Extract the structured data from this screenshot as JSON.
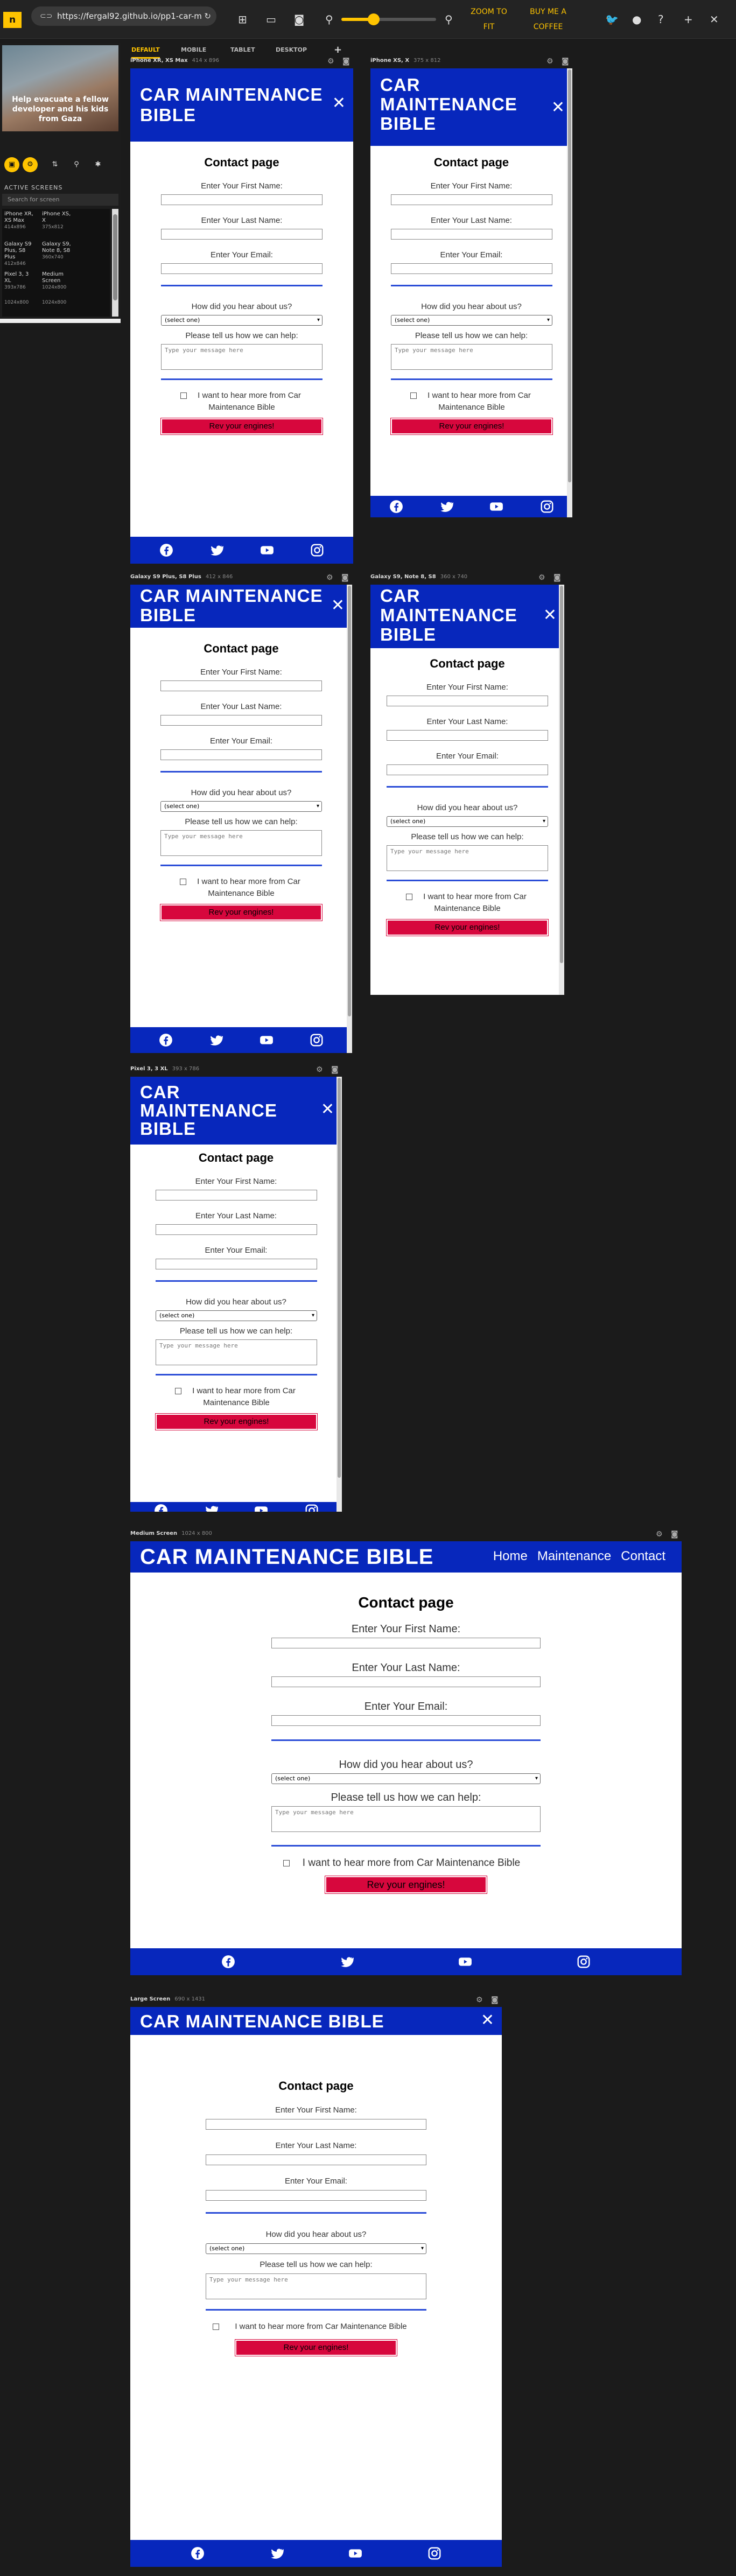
{
  "toolbar": {
    "logo": "n",
    "url": "https://fergal92.github.io/pp1-car-m",
    "zoom_level": 0.34,
    "zoom_to_fit": "ZOOM TO FIT",
    "buy_coffee": "BUY ME A COFFEE"
  },
  "tabs": [
    "DEFAULT",
    "MOBILE",
    "TABLET",
    "DESKTOP"
  ],
  "sidebar": {
    "ad_text": "Help evacuate a fellow developer and his kids from Gaza",
    "active_screens": "ACTIVE SCREENS",
    "search_placeholder": "Search for screen",
    "devices": [
      {
        "name": "iPhone XR, XS Max",
        "size": "414x896"
      },
      {
        "name": "iPhone XS, X",
        "size": "375x812"
      },
      {
        "name": "Galaxy S9 Plus, S8 Plus",
        "size": "412x846"
      },
      {
        "name": "Galaxy S9, Note 8, S8",
        "size": "360x740"
      },
      {
        "name": "Pixel 3, 3 XL",
        "size": "393x786"
      },
      {
        "name": "Medium Screen",
        "size": "1024x800"
      },
      {
        "name": "Large Screen",
        "size": "1024x800"
      },
      {
        "name": "",
        "size": "1024x800"
      }
    ]
  },
  "site": {
    "brand": "CAR MAINTENANCE BIBLE",
    "brand_lines": [
      "CAR MAINTENANCE",
      "BIBLE"
    ],
    "brand_lines_small": [
      "CAR",
      "MAINTENANCE",
      "BIBLE"
    ],
    "nav": [
      "Home",
      "Maintenance",
      "Contact"
    ],
    "contact_title": "Contact page",
    "first_name": "Enter Your First Name:",
    "last_name": "Enter Your Last Name:",
    "email": "Enter Your Email:",
    "hear_about": "How did you hear about us?",
    "select_default": "(select one)",
    "help_label": "Please tell us how we can help:",
    "message_placeholder": "Type your message here",
    "checkbox_text": "I want to hear more from Car Maintenance Bible",
    "checkbox_lines": [
      "I want to hear more from Car",
      "Maintenance Bible"
    ],
    "submit": "Rev your engines!"
  },
  "frames": [
    {
      "label": "iPhone XR, XS Max",
      "size": "414 x 896"
    },
    {
      "label": "iPhone XS, X",
      "size": "375 x 812"
    },
    {
      "label": "Galaxy S9 Plus, S8 Plus",
      "size": "412 x 846"
    },
    {
      "label": "Galaxy S9, Note 8, S8",
      "size": "360 x 740"
    },
    {
      "label": "Pixel 3, 3 XL",
      "size": "393 x 786"
    },
    {
      "label": "Medium Screen",
      "size": "1024 x 800"
    },
    {
      "label": "Large Screen",
      "size": "690 x 1431"
    }
  ],
  "colors": {
    "brand_blue": "#0727bc",
    "rule_blue": "#2a4cd7",
    "submit_red": "#d7073d",
    "accent": "#ffc400"
  }
}
